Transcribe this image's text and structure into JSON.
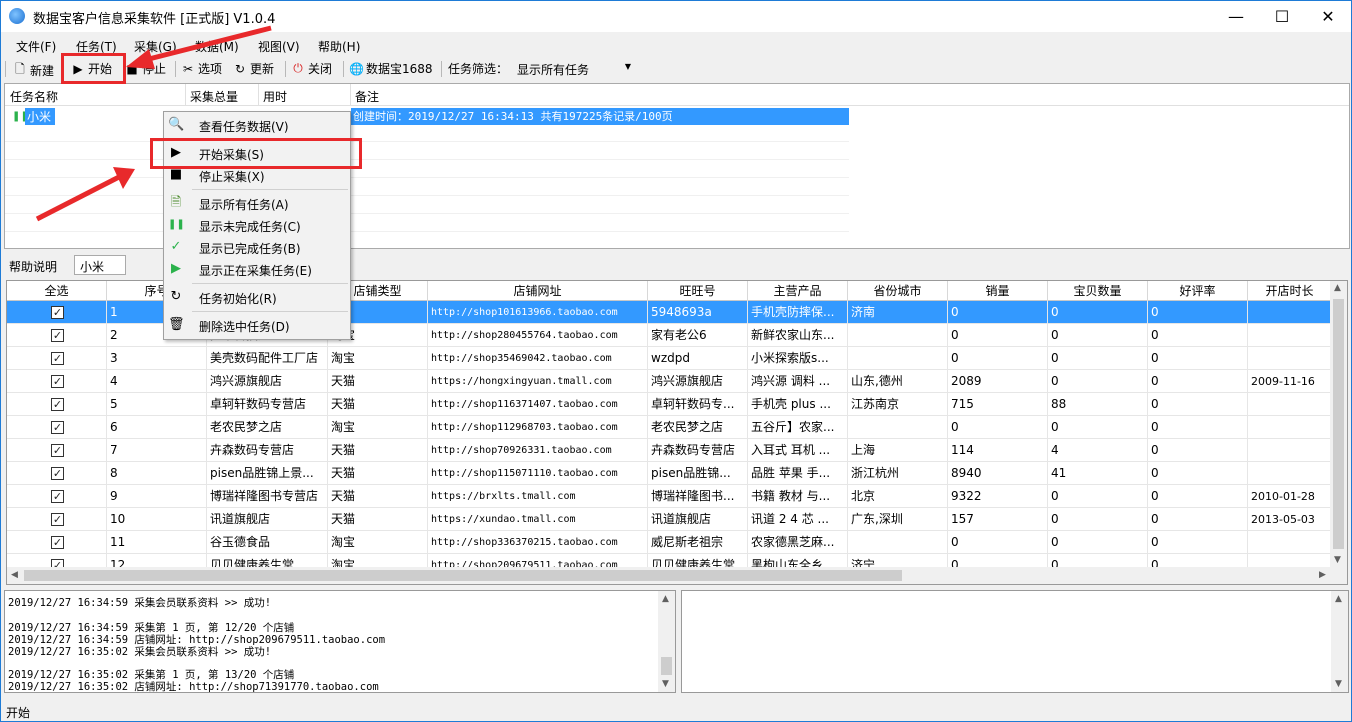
{
  "window": {
    "title": "数据宝客户信息采集软件 [正式版] V1.0.4"
  },
  "menubar": [
    "文件(F)",
    "任务(T)",
    "采集(G)",
    "数据(M)",
    "视图(V)",
    "帮助(H)"
  ],
  "toolbar": {
    "new": "新建",
    "start": "开始",
    "stop": "停止",
    "options": "选项",
    "update": "更新",
    "close": "关闭",
    "site": "数据宝1688",
    "filter_label": "任务筛选：",
    "filter_value": "显示所有任务"
  },
  "tasklist": {
    "headers": [
      "任务名称",
      "采集总量",
      "用时",
      "备注"
    ],
    "row": {
      "name": "小米",
      "note": "创建时间：2019/12/27 16:34:13 共有197225条记录/100页"
    }
  },
  "help": {
    "label": "帮助说明",
    "value": "小米"
  },
  "grid": {
    "headers": [
      "全选",
      "序号",
      "店铺名称",
      "店铺类型",
      "店铺网址",
      "旺旺号",
      "主营产品",
      "省份城市",
      "销量",
      "宝贝数量",
      "好评率",
      "开店时长"
    ],
    "rows": [
      [
        "1",
        "",
        "",
        "http://shop101613966.taobao.com",
        "5948693a",
        "手机壳防摔保...",
        "济南",
        "0",
        "0",
        "0",
        ""
      ],
      [
        "2",
        "宽带科技店",
        "淘宝",
        "http://shop280455764.taobao.com",
        "家有老公6",
        "新鲜农家山东...",
        "",
        "0",
        "0",
        "0",
        ""
      ],
      [
        "3",
        "美壳数码配件工厂店",
        "淘宝",
        "http://shop35469042.taobao.com",
        "wzdpd",
        "小米探索版s...",
        "",
        "0",
        "0",
        "0",
        ""
      ],
      [
        "4",
        "鸿兴源旗舰店",
        "天猫",
        "https://hongxingyuan.tmall.com",
        "鸿兴源旗舰店",
        "鸿兴源 调料 ...",
        "山东,德州",
        "2089",
        "0",
        "0",
        "2009-11-16"
      ],
      [
        "5",
        "卓轲轩数码专营店",
        "天猫",
        "http://shop116371407.taobao.com",
        "卓轲轩数码专...",
        "手机壳 plus ...",
        "江苏南京",
        "715",
        "88",
        "0",
        ""
      ],
      [
        "6",
        "老农民梦之店",
        "淘宝",
        "http://shop112968703.taobao.com",
        "老农民梦之店",
        "五谷斤】农家...",
        "",
        "0",
        "0",
        "0",
        ""
      ],
      [
        "7",
        "卉森数码专营店",
        "天猫",
        "http://shop70926331.taobao.com",
        "卉森数码专营店",
        "入耳式 耳机 ...",
        "上海",
        "114",
        "4",
        "0",
        ""
      ],
      [
        "8",
        "pisen品胜锦上景...",
        "天猫",
        "http://shop115071110.taobao.com",
        "pisen品胜锦...",
        "品胜 苹果 手...",
        "浙江杭州",
        "8940",
        "41",
        "0",
        ""
      ],
      [
        "9",
        "博瑞祥隆图书专营店",
        "天猫",
        "https://brxlts.tmall.com",
        "博瑞祥隆图书...",
        "书籍 教材 与...",
        "北京",
        "9322",
        "0",
        "0",
        "2010-01-28"
      ],
      [
        "10",
        "讯道旗舰店",
        "天猫",
        "https://xundao.tmall.com",
        "讯道旗舰店",
        "讯道 2 4 芯 ...",
        "广东,深圳",
        "157",
        "0",
        "0",
        "2013-05-03"
      ],
      [
        "11",
        "谷玉德食品",
        "淘宝",
        "http://shop336370215.taobao.com",
        "威尼斯老祖宗",
        "农家德黑芝麻...",
        "",
        "0",
        "0",
        "0",
        ""
      ],
      [
        "12",
        "贝贝健康养生堂",
        "淘宝",
        "http://shop209679511.taobao.com",
        "贝贝健康养生堂",
        "黑枸山东全乡...",
        "济宁",
        "0",
        "0",
        "0",
        ""
      ]
    ]
  },
  "context_menu": [
    "查看任务数据(V)",
    "开始采集(S)",
    "停止采集(X)",
    "显示所有任务(A)",
    "显示未完成任务(C)",
    "显示已完成任务(B)",
    "显示正在采集任务(E)",
    "任务初始化(R)",
    "删除选中任务(D)"
  ],
  "log": [
    "2019/12/27 16:34:59 采集会员联系资料 >> 成功!",
    "",
    "2019/12/27 16:34:59 采集第 1 页, 第 12/20 个店铺",
    "2019/12/27 16:34:59 店铺网址: http://shop209679511.taobao.com",
    "2019/12/27 16:35:02 采集会员联系资料 >> 成功!",
    "",
    "2019/12/27 16:35:02 采集第 1 页, 第 13/20 个店铺",
    "2019/12/27 16:35:02 店铺网址: http://shop71391770.taobao.com"
  ],
  "status": "开始",
  "colors": {
    "selection": "#3399ff",
    "annotation": "#e8292b",
    "pause": "#2bb24c"
  }
}
